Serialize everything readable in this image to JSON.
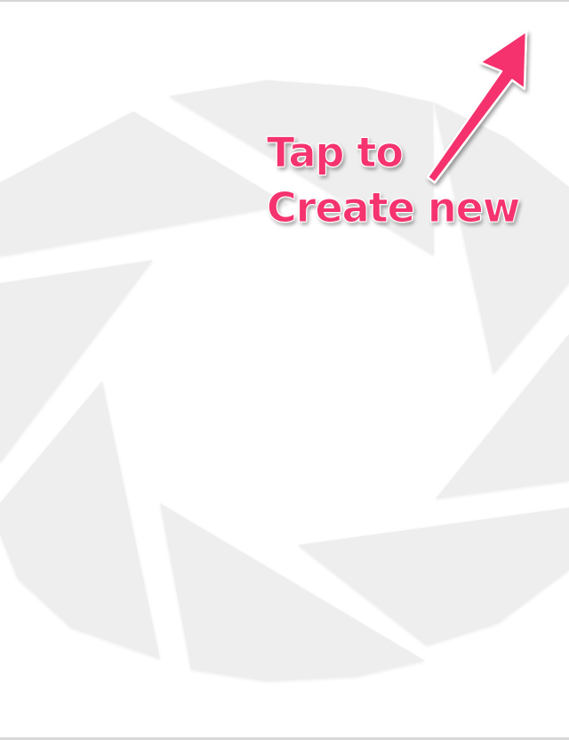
{
  "hint": {
    "line1": "Tap to",
    "line2": "Create new"
  },
  "colors": {
    "background": "#ffffff",
    "aperture_blades": "#eeeeee",
    "accent": "#f5336e"
  },
  "icons": {
    "background_logo": "aperture-icon",
    "pointer": "arrow-up-right-icon"
  }
}
